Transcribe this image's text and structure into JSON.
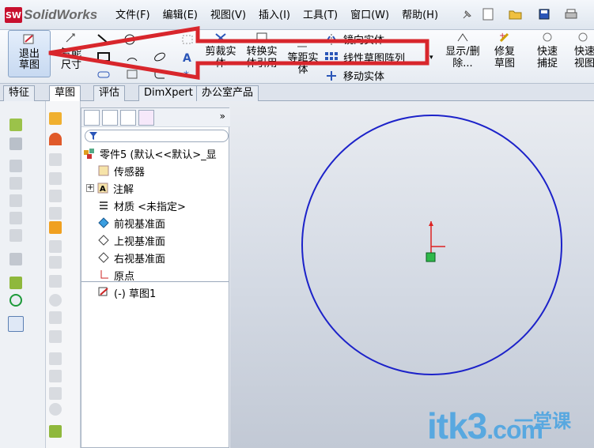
{
  "app": {
    "logo_mark": "SW",
    "logo_text": "SolidWorks"
  },
  "menu": [
    "文件(F)",
    "编辑(E)",
    "视图(V)",
    "插入(I)",
    "工具(T)",
    "窗口(W)",
    "帮助(H)"
  ],
  "ribbon": {
    "exit_sketch": "退出草图",
    "smart_dim": "智能尺寸",
    "trim": "剪裁实体",
    "convert": "转换实体引用",
    "offset": "等距实体",
    "mirror": "镜向实体",
    "linear_pattern": "线性草图阵列",
    "move": "移动实体",
    "show_delete": "显示/删除...",
    "repair": "修复草图",
    "quick_snap": "快速捕捉",
    "quick_view": "快速视图"
  },
  "tabs": [
    "特征",
    "草图",
    "评估",
    "DimXpert",
    "办公室产品"
  ],
  "tree": {
    "part": "零件5 (默认<<默认>_显",
    "sensors": "传感器",
    "annotations": "注解",
    "material": "材质 <未指定>",
    "front_plane": "前视基准面",
    "top_plane": "上视基准面",
    "right_plane": "右视基准面",
    "origin": "原点",
    "sketch": "(-) 草图1"
  },
  "watermark": {
    "text": "itk3",
    "domain": ".com",
    "cn": "一堂课"
  },
  "colors": {
    "circle": "#1c22c9",
    "arrow": "#d8262c",
    "accent": "#58a8e0"
  }
}
